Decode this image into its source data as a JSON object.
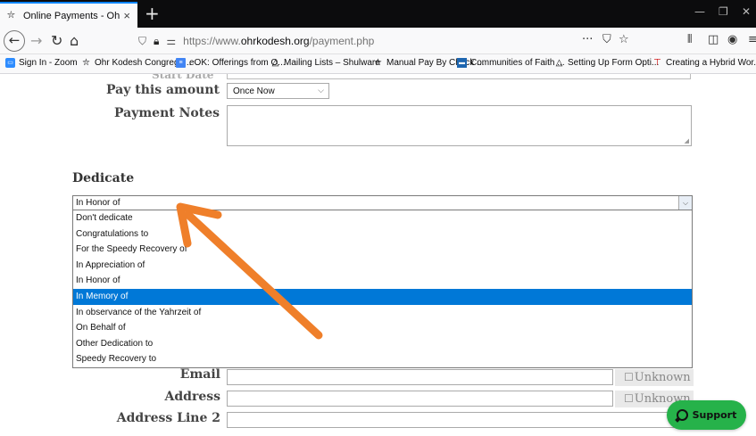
{
  "browser": {
    "tab_title": "Online Payments - Ohr Kodesh",
    "tab_close": "×",
    "new_tab": "+",
    "url_prefix": "https://www.",
    "url_domain": "ohrkodesh.org",
    "url_path": "/payment.php",
    "page_actions": "···"
  },
  "bookmarks": [
    {
      "icon": "zoom",
      "label": "Sign In - Zoom"
    },
    {
      "icon": "ohr",
      "label": "Ohr Kodesh Congrega..."
    },
    {
      "icon": "doc",
      "label": "eOK: Offerings from O..."
    },
    {
      "icon": "tri",
      "label": "Mailing Lists – Shulware"
    },
    {
      "icon": "ohr",
      "label": "Manual Pay By Check ..."
    },
    {
      "icon": "blue",
      "label": "Communities of Faith ..."
    },
    {
      "icon": "tri",
      "label": "Setting Up Form Opti..."
    },
    {
      "icon": "red",
      "label": "Creating a Hybrid Wor..."
    }
  ],
  "form": {
    "cut_label": "Start Date",
    "pay_amount_label": "Pay this amount",
    "pay_amount_value": "Once Now",
    "payment_notes_label": "Payment Notes",
    "dedicate_heading": "Dedicate",
    "dedicate_selected": "In Honor of",
    "dedicate_options": [
      "Don't dedicate",
      "Congratulations to",
      "For the Speedy Recovery of",
      "In Appreciation of",
      "In Honor of",
      "In Memory of",
      "In observance of the Yahrzeit of",
      "On Behalf of",
      "Other Dedication to",
      "Speedy Recovery to"
    ],
    "dedicate_highlighted_index": 5,
    "email_label": "Email",
    "address_label": "Address",
    "address2_label": "Address Line 2",
    "unknown_label": "Unknown",
    "support_label": "Support"
  },
  "colors": {
    "highlight": "#0078d7",
    "support": "#26b24a",
    "arrow": "#ef7f2a"
  }
}
